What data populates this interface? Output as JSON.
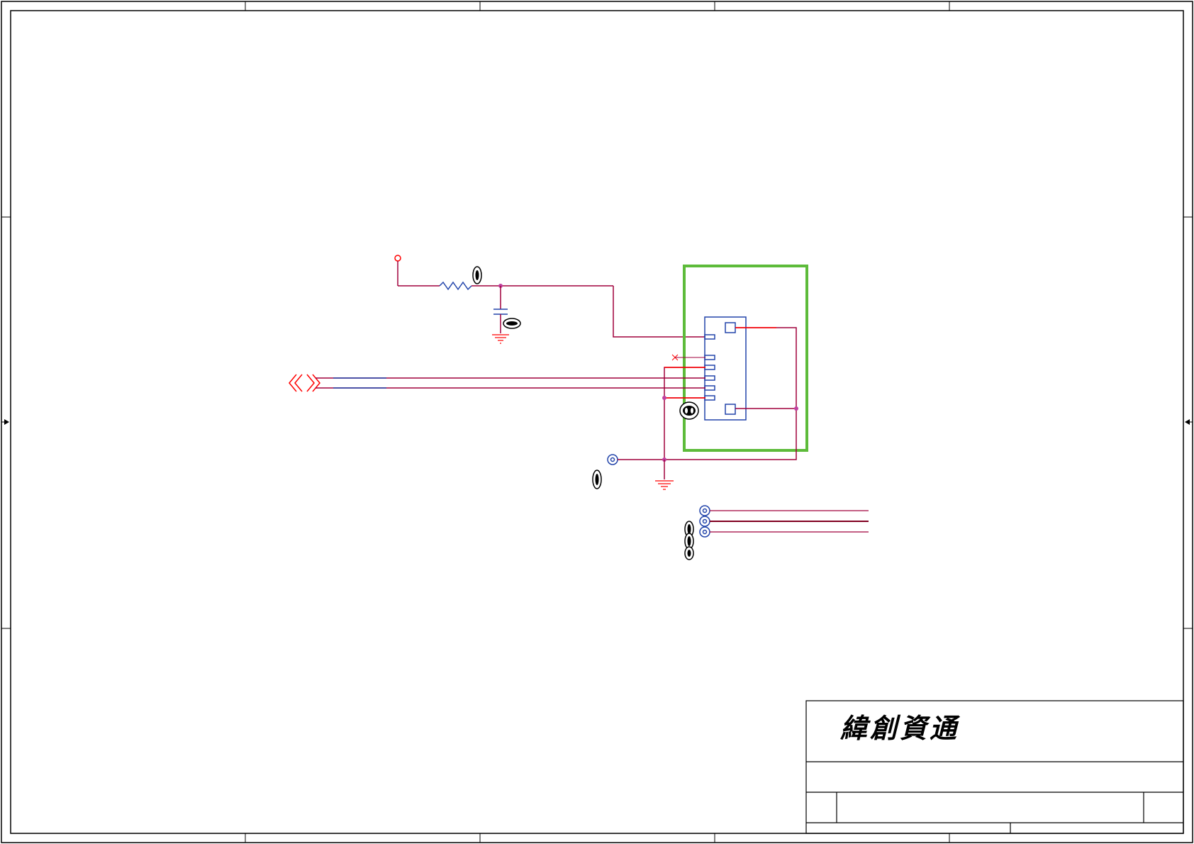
{
  "title_block": {
    "company_logo_text": "緯創資通"
  },
  "colors": {
    "frame": "#000000",
    "net_wire": "#a0003c",
    "net_wire_red": "#ff0000",
    "component_blue": "#2244aa",
    "junction_dot": "#c040a0",
    "highlight_box": "#5dbb3a",
    "ground": "#ff0000"
  },
  "components": {
    "power_port": "power-port-icon",
    "resistor": "resistor-icon",
    "capacitor": "capacitor-icon",
    "connector": "connector-icon",
    "test_points": "test-point-icon",
    "grounds": "ground-icon",
    "offpage_connectors": "offpage-connector-icon"
  }
}
